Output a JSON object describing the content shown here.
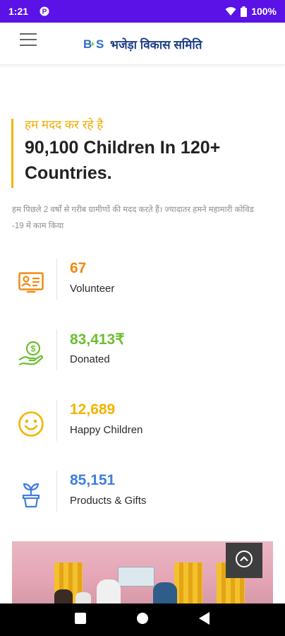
{
  "status": {
    "time": "1:21",
    "battery": "100%"
  },
  "header": {
    "brand_logo": "B+S",
    "brand_name": "भजेड़ा विकास समिति"
  },
  "hero": {
    "kicker": "हम मदद कर रहे है",
    "headline_line1": "90,100 Children In 120+",
    "headline_line2": "Countries."
  },
  "description": "हम पिछले 2 वर्षों से गरीब ग्रामीणों की मदद करते हैं। ज्यादातर हमने महामारी कोविड -19  में काम किया",
  "stats": [
    {
      "value": "67",
      "label": "Volunteer",
      "color": "#f08a12",
      "icon": "volunteer-card-icon"
    },
    {
      "value": "83,413₹",
      "label": "Donated",
      "color": "#6cbf2e",
      "icon": "donation-hand-icon"
    },
    {
      "value": "12,689",
      "label": "Happy Children",
      "color": "#f2b400",
      "icon": "smiley-icon"
    },
    {
      "value": "85,151",
      "label": "Products & Gifts",
      "color": "#3f7ee0",
      "icon": "plant-pot-icon"
    }
  ],
  "colors": {
    "status_bar": "#5a12e6",
    "brand": "#1f3f86",
    "accent": "#f5b300"
  }
}
